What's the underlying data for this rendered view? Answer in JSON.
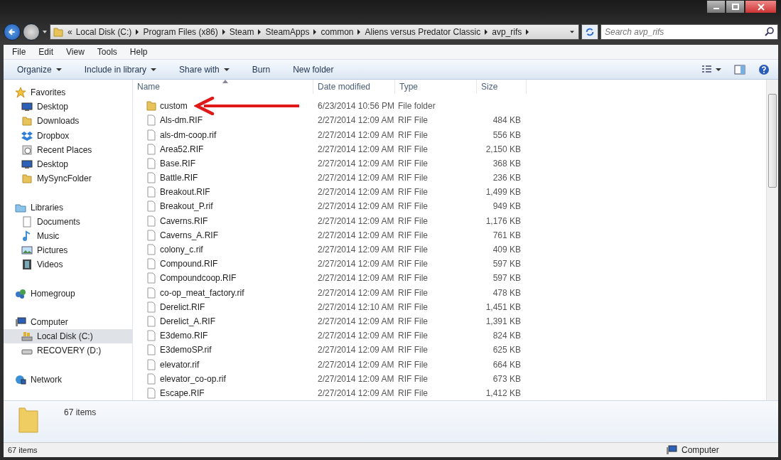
{
  "address": {
    "overflow": "«",
    "segments": [
      "Local Disk (C:)",
      "Program Files (x86)",
      "Steam",
      "SteamApps",
      "common",
      "Aliens versus Predator Classic",
      "avp_rifs"
    ]
  },
  "search": {
    "placeholder": "Search avp_rifs"
  },
  "menu": [
    "File",
    "Edit",
    "View",
    "Tools",
    "Help"
  ],
  "commands": [
    {
      "label": "Organize",
      "dropdown": true
    },
    {
      "label": "Include in library",
      "dropdown": true
    },
    {
      "label": "Share with",
      "dropdown": true
    },
    {
      "label": "Burn",
      "dropdown": false
    },
    {
      "label": "New folder",
      "dropdown": false
    }
  ],
  "sidebar": [
    {
      "label": "Favorites",
      "kind": "star",
      "children": [
        {
          "label": "Desktop",
          "kind": "desktop",
          "selected": false
        },
        {
          "label": "Downloads",
          "kind": "folder",
          "selected": false
        },
        {
          "label": "Dropbox",
          "kind": "dropbox",
          "selected": false
        },
        {
          "label": "Recent Places",
          "kind": "recent",
          "selected": false
        },
        {
          "label": "Desktop",
          "kind": "desktop",
          "selected": false
        },
        {
          "label": "MySyncFolder",
          "kind": "folder",
          "selected": false
        }
      ]
    },
    {
      "label": "Libraries",
      "kind": "library",
      "children": [
        {
          "label": "Documents",
          "kind": "document",
          "selected": false
        },
        {
          "label": "Music",
          "kind": "music",
          "selected": false
        },
        {
          "label": "Pictures",
          "kind": "pictures",
          "selected": false
        },
        {
          "label": "Videos",
          "kind": "videos",
          "selected": false
        }
      ]
    },
    {
      "label": "Homegroup",
      "kind": "homegroup"
    },
    {
      "label": "Computer",
      "kind": "computer",
      "children": [
        {
          "label": "Local Disk (C:)",
          "kind": "disk",
          "selected": true
        },
        {
          "label": "RECOVERY (D:)",
          "kind": "drive",
          "selected": false
        }
      ]
    },
    {
      "label": "Network",
      "kind": "network"
    }
  ],
  "columns": [
    "Name",
    "Date modified",
    "Type",
    "Size"
  ],
  "files": [
    {
      "kind": "folder",
      "name": "custom",
      "date": "6/23/2014 10:56 PM",
      "type": "File folder"
    },
    {
      "kind": "file",
      "name": "Als-dm.RIF",
      "date": "2/27/2014 12:09 AM",
      "type": "RIF File",
      "size": "484 KB"
    },
    {
      "kind": "file",
      "name": "als-dm-coop.rif",
      "date": "2/27/2014 12:09 AM",
      "type": "RIF File",
      "size": "556 KB"
    },
    {
      "kind": "file",
      "name": "Area52.RIF",
      "date": "2/27/2014 12:09 AM",
      "type": "RIF File",
      "size": "2,150 KB"
    },
    {
      "kind": "file",
      "name": "Base.RIF",
      "date": "2/27/2014 12:09 AM",
      "type": "RIF File",
      "size": "368 KB"
    },
    {
      "kind": "file",
      "name": "Battle.RIF",
      "date": "2/27/2014 12:09 AM",
      "type": "RIF File",
      "size": "236 KB"
    },
    {
      "kind": "file",
      "name": "Breakout.RIF",
      "date": "2/27/2014 12:09 AM",
      "type": "RIF File",
      "size": "1,499 KB"
    },
    {
      "kind": "file",
      "name": "Breakout_P.rif",
      "date": "2/27/2014 12:09 AM",
      "type": "RIF File",
      "size": "949 KB"
    },
    {
      "kind": "file",
      "name": "Caverns.RIF",
      "date": "2/27/2014 12:09 AM",
      "type": "RIF File",
      "size": "1,176 KB"
    },
    {
      "kind": "file",
      "name": "Caverns_A.RIF",
      "date": "2/27/2014 12:09 AM",
      "type": "RIF File",
      "size": "761 KB"
    },
    {
      "kind": "file",
      "name": "colony_c.rif",
      "date": "2/27/2014 12:09 AM",
      "type": "RIF File",
      "size": "409 KB"
    },
    {
      "kind": "file",
      "name": "Compound.RIF",
      "date": "2/27/2014 12:09 AM",
      "type": "RIF File",
      "size": "597 KB"
    },
    {
      "kind": "file",
      "name": "Compoundcoop.RIF",
      "date": "2/27/2014 12:09 AM",
      "type": "RIF File",
      "size": "597 KB"
    },
    {
      "kind": "file",
      "name": "co-op_meat_factory.rif",
      "date": "2/27/2014 12:09 AM",
      "type": "RIF File",
      "size": "478 KB"
    },
    {
      "kind": "file",
      "name": "Derelict.RIF",
      "date": "2/27/2014 12:10 AM",
      "type": "RIF File",
      "size": "1,451 KB"
    },
    {
      "kind": "file",
      "name": "Derelict_A.RIF",
      "date": "2/27/2014 12:09 AM",
      "type": "RIF File",
      "size": "1,391 KB"
    },
    {
      "kind": "file",
      "name": "E3demo.RIF",
      "date": "2/27/2014 12:09 AM",
      "type": "RIF File",
      "size": "824 KB"
    },
    {
      "kind": "file",
      "name": "E3demoSP.rif",
      "date": "2/27/2014 12:09 AM",
      "type": "RIF File",
      "size": "625 KB"
    },
    {
      "kind": "file",
      "name": "elevator.rif",
      "date": "2/27/2014 12:09 AM",
      "type": "RIF File",
      "size": "664 KB"
    },
    {
      "kind": "file",
      "name": "elevator_co-op.rif",
      "date": "2/27/2014 12:09 AM",
      "type": "RIF File",
      "size": "673 KB"
    },
    {
      "kind": "file",
      "name": "Escape.RIF",
      "date": "2/27/2014 12:09 AM",
      "type": "RIF File",
      "size": "1,412 KB"
    }
  ],
  "details": {
    "count": "67 items"
  },
  "status_bar": {
    "count": "67 items",
    "zone": "Computer"
  }
}
